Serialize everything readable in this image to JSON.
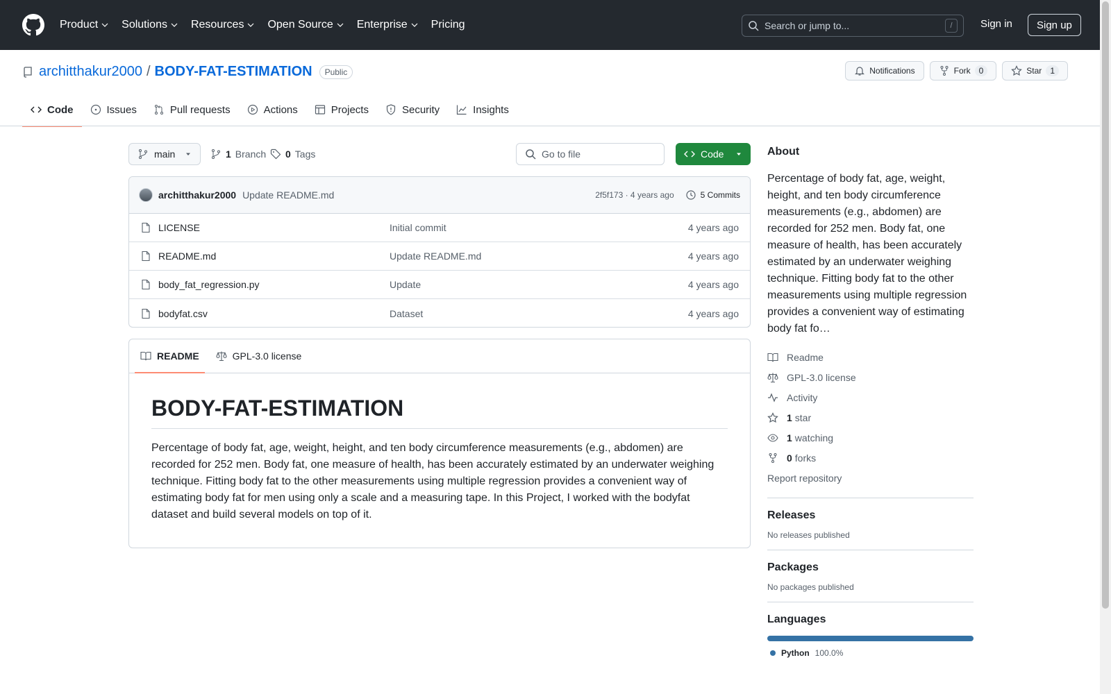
{
  "header": {
    "nav": [
      "Product",
      "Solutions",
      "Resources",
      "Open Source",
      "Enterprise",
      "Pricing"
    ],
    "search_placeholder": "Search or jump to...",
    "search_shortcut": "/",
    "sign_in": "Sign in",
    "sign_up": "Sign up"
  },
  "repo": {
    "owner": "architthakur2000",
    "separator": "/",
    "name": "BODY-FAT-ESTIMATION",
    "visibility": "Public",
    "notifications_label": "Notifications",
    "fork_label": "Fork",
    "fork_count": "0",
    "star_label": "Star",
    "star_count": "1"
  },
  "tabs": [
    "Code",
    "Issues",
    "Pull requests",
    "Actions",
    "Projects",
    "Security",
    "Insights"
  ],
  "toolbar": {
    "branch": "main",
    "branch_count": "1",
    "branch_label": "Branch",
    "tag_count": "0",
    "tag_label": "Tags",
    "goto_file": "Go to file",
    "code_button": "Code"
  },
  "latest_commit": {
    "author": "architthakur2000",
    "message": "Update README.md",
    "hash_age": "2f5f173 · 4 years ago",
    "commits": "5 Commits"
  },
  "files": [
    {
      "name": "LICENSE",
      "commit": "Initial commit",
      "age": "4 years ago"
    },
    {
      "name": "README.md",
      "commit": "Update README.md",
      "age": "4 years ago"
    },
    {
      "name": "body_fat_regression.py",
      "commit": "Update",
      "age": "4 years ago"
    },
    {
      "name": "bodyfat.csv",
      "commit": "Dataset",
      "age": "4 years ago"
    }
  ],
  "readme": {
    "tab_readme": "README",
    "tab_license": "GPL-3.0 license",
    "title": "BODY-FAT-ESTIMATION",
    "body": "Percentage of body fat, age, weight, height, and ten body circumference measurements (e.g., abdomen) are recorded for 252 men. Body fat, one measure of health, has been accurately estimated by an underwater weighing technique. Fitting body fat to the other measurements using multiple regression provides a convenient way of estimating body fat for men using only a scale and a measuring tape. In this Project, I worked with the bodyfat dataset and build several models on top of it."
  },
  "sidebar": {
    "about_title": "About",
    "about_text": "Percentage of body fat, age, weight, height, and ten body circumference measurements (e.g., abdomen) are recorded for 252 men. Body fat, one measure of health, has been accurately estimated by an underwater weighing technique. Fitting body fat to the other measurements using multiple regression provides a convenient way of estimating body fat fo…",
    "readme": "Readme",
    "license": "GPL-3.0 license",
    "activity": "Activity",
    "stars_count": "1",
    "stars_label": "star",
    "watching_count": "1",
    "watching_label": "watching",
    "forks_count": "0",
    "forks_label": "forks",
    "report": "Report repository",
    "releases_title": "Releases",
    "releases_text": "No releases published",
    "packages_title": "Packages",
    "packages_text": "No packages published",
    "languages_title": "Languages",
    "language_name": "Python",
    "language_pct": "100.0%",
    "language_color": "#3572A5"
  }
}
